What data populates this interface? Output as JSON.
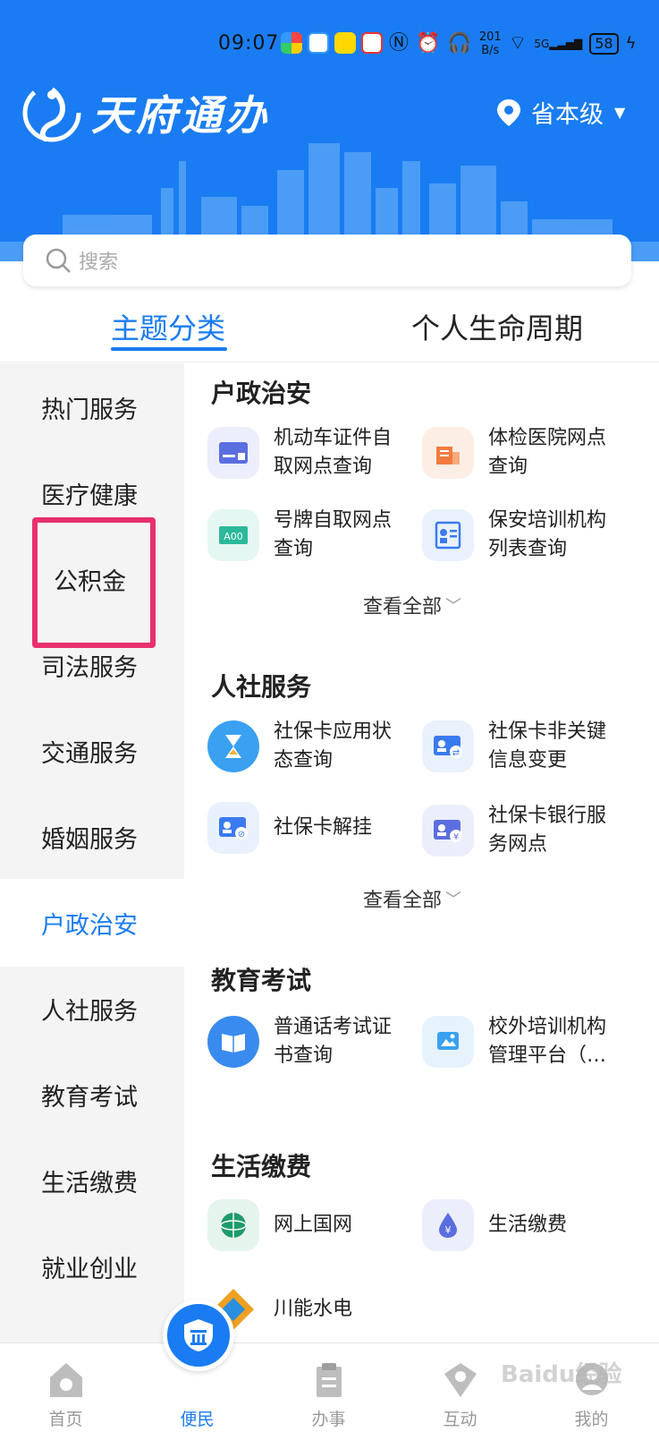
{
  "status_bar": {
    "time": "09:07",
    "net_speed_value": "201",
    "net_speed_unit": "B/s",
    "signal": "5G",
    "battery": "58"
  },
  "header": {
    "app_name": "天府通办",
    "location": "省本级"
  },
  "search": {
    "placeholder": "搜索"
  },
  "tabs": [
    {
      "label": "主题分类",
      "active": true
    },
    {
      "label": "个人生命周期",
      "active": false
    }
  ],
  "sidebar": {
    "items": [
      {
        "label": "热门服务"
      },
      {
        "label": "医疗健康"
      },
      {
        "label": "公积金"
      },
      {
        "label": "司法服务"
      },
      {
        "label": "交通服务"
      },
      {
        "label": "婚姻服务"
      },
      {
        "label": "户政治安",
        "active": true
      },
      {
        "label": "人社服务"
      },
      {
        "label": "教育考试"
      },
      {
        "label": "生活缴费"
      },
      {
        "label": "就业创业"
      }
    ]
  },
  "sections": [
    {
      "title": "户政治安",
      "view_all": "查看全部",
      "services": [
        {
          "label": "机动车证件自取网点查询",
          "icon": "id-card-icon",
          "color": "#5b6ee0"
        },
        {
          "label": "体检医院网点查询",
          "icon": "hospital-icon",
          "color": "#f37b3f"
        },
        {
          "label": "号牌自取网点查询",
          "icon": "license-plate-icon",
          "color": "#2cb99a"
        },
        {
          "label": "保安培训机构列表查询",
          "icon": "profile-card-icon",
          "color": "#3a7bf0"
        }
      ]
    },
    {
      "title": "人社服务",
      "view_all": "查看全部",
      "services": [
        {
          "label": "社保卡应用状态查询",
          "icon": "hourglass-icon",
          "color": "#3aa0f0"
        },
        {
          "label": "社保卡非关键信息变更",
          "icon": "card-edit-icon",
          "color": "#3a7bf0"
        },
        {
          "label": "社保卡解挂",
          "icon": "card-unlink-icon",
          "color": "#3a7bf0"
        },
        {
          "label": "社保卡银行服务网点",
          "icon": "card-bank-icon",
          "color": "#5b6ee0"
        }
      ]
    },
    {
      "title": "教育考试",
      "services": [
        {
          "label": "普通话考试证书查询",
          "icon": "book-icon",
          "color": "#3a7bf0"
        },
        {
          "label": "校外培训机构管理平台（…",
          "icon": "training-icon",
          "color": "#3aa0f0"
        }
      ]
    },
    {
      "title": "生活缴费",
      "services": [
        {
          "label": "网上国网",
          "icon": "state-grid-icon",
          "color": "#1e9b6b"
        },
        {
          "label": "生活缴费",
          "icon": "water-drop-icon",
          "color": "#5b6ee0"
        },
        {
          "label": "川能水电",
          "icon": "sichuan-energy-icon",
          "color": "#f0a020"
        }
      ]
    }
  ],
  "bottom_nav": [
    {
      "label": "首页"
    },
    {
      "label": "便民",
      "active": true
    },
    {
      "label": "办事"
    },
    {
      "label": "互动"
    },
    {
      "label": "我的"
    }
  ],
  "watermark": "Baidu经验"
}
